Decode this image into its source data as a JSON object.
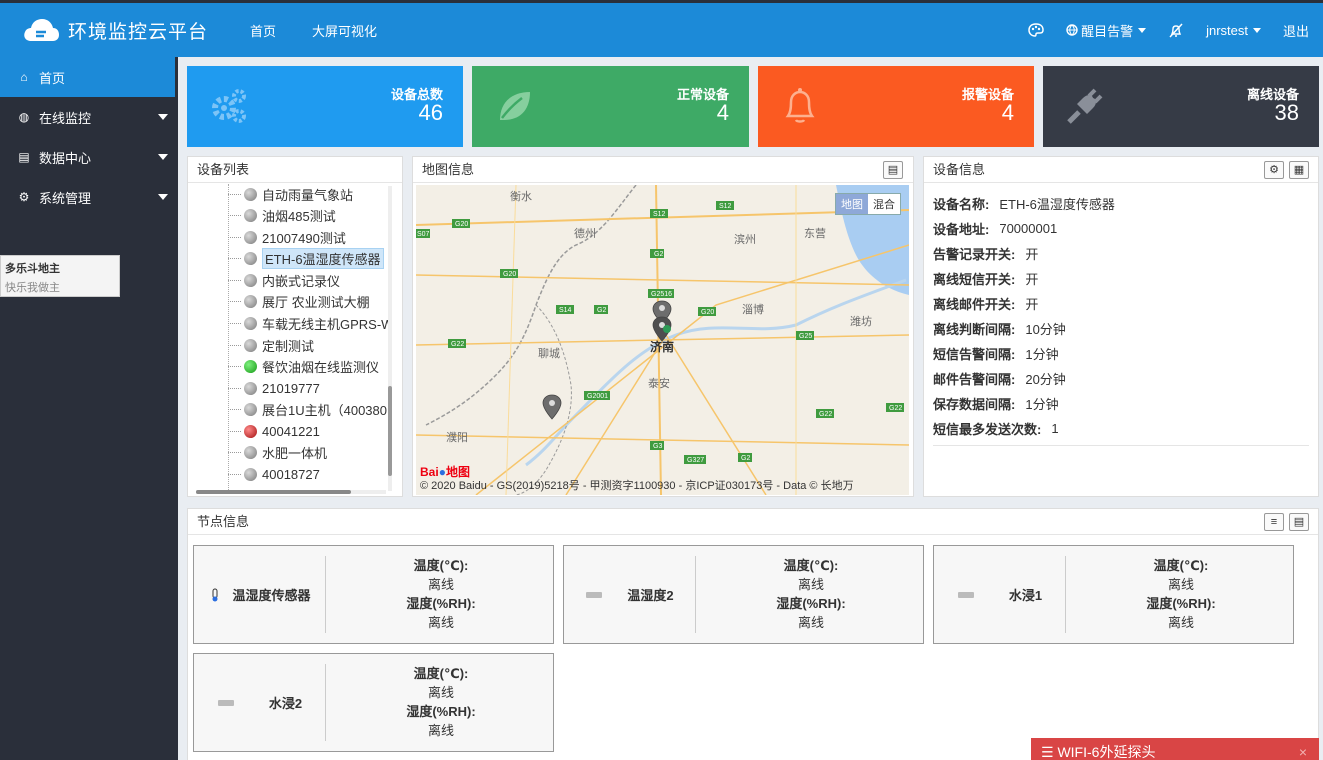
{
  "header": {
    "title": "环境监控云平台",
    "nav": [
      "首页",
      "大屏可视化"
    ],
    "alarm_label": "醒目告警",
    "username": "jnrstest",
    "logout": "退出"
  },
  "sidebar": {
    "items": [
      {
        "label": "首页",
        "icon": "home-icon"
      },
      {
        "label": "在线监控",
        "icon": "globe-icon"
      },
      {
        "label": "数据中心",
        "icon": "table-icon"
      },
      {
        "label": "系统管理",
        "icon": "gear-icon"
      }
    ],
    "tooltip": {
      "title": "多乐斗地主",
      "subtitle": "快乐我做主"
    }
  },
  "stats": [
    {
      "label": "设备总数",
      "value": "46",
      "color": "#1f9bf0",
      "icon": "gears-icon"
    },
    {
      "label": "正常设备",
      "value": "4",
      "color": "#3eaa66",
      "icon": "leaf-icon"
    },
    {
      "label": "报警设备",
      "value": "4",
      "color": "#fb5a21",
      "icon": "bell-icon"
    },
    {
      "label": "离线设备",
      "value": "38",
      "color": "#363b46",
      "icon": "plug-icon"
    }
  ],
  "device_list": {
    "title": "设备列表",
    "items": [
      {
        "label": "自动雨量气象站",
        "status": "offline"
      },
      {
        "label": "油烟485测试",
        "status": "offline"
      },
      {
        "label": "21007490测试",
        "status": "offline"
      },
      {
        "label": "ETH-6温湿度传感器",
        "status": "offline",
        "selected": true
      },
      {
        "label": "内嵌式记录仪",
        "status": "offline"
      },
      {
        "label": "展厅 农业测试大棚",
        "status": "offline"
      },
      {
        "label": "车载无线主机GPRS-W",
        "status": "offline"
      },
      {
        "label": "定制测试",
        "status": "offline"
      },
      {
        "label": "餐饮油烟在线监测仪",
        "status": "online"
      },
      {
        "label": "21019777",
        "status": "offline"
      },
      {
        "label": "展台1U主机（400380",
        "status": "offline"
      },
      {
        "label": "40041221",
        "status": "alarm"
      },
      {
        "label": "水肥一体机",
        "status": "offline"
      },
      {
        "label": "40018727",
        "status": "offline"
      }
    ]
  },
  "map": {
    "title": "地图信息",
    "toggle": [
      "地图",
      "混合"
    ],
    "copyright": "© 2020 Baidu - GS(2019)5218号 - 甲测资字1100930 - 京ICP证030173号 - Data © 长地万",
    "logo": "Bai地图",
    "cities": [
      "衡水",
      "德州",
      "滨州",
      "东营",
      "淄博",
      "潍坊",
      "济南",
      "聊城",
      "泰安",
      "濮阳"
    ],
    "roads": [
      "G20",
      "S12",
      "S12",
      "G2",
      "G20",
      "G2516",
      "S14",
      "G2",
      "G20",
      "G22",
      "G25",
      "G22",
      "G2001",
      "G3",
      "G327",
      "G2",
      "G22",
      "G22",
      "S07"
    ]
  },
  "device_info": {
    "title": "设备信息",
    "fields": [
      {
        "k": "设备名称:",
        "v": "ETH-6温湿度传感器"
      },
      {
        "k": "设备地址:",
        "v": "70000001"
      },
      {
        "k": "告警记录开关:",
        "v": "开"
      },
      {
        "k": "离线短信开关:",
        "v": "开"
      },
      {
        "k": "离线邮件开关:",
        "v": "开"
      },
      {
        "k": "离线判断间隔:",
        "v": "10分钟"
      },
      {
        "k": "短信告警间隔:",
        "v": "1分钟"
      },
      {
        "k": "邮件告警间隔:",
        "v": "20分钟"
      },
      {
        "k": "保存数据间隔:",
        "v": "1分钟"
      },
      {
        "k": "短信最多发送次数:",
        "v": "1"
      }
    ]
  },
  "nodes": {
    "title": "节点信息",
    "items": [
      {
        "name": "温湿度传感器",
        "icon": "thermometer-icon",
        "t_label": "温度(℃):",
        "t_val": "离线",
        "h_label": "湿度(%RH):",
        "h_val": "离线"
      },
      {
        "name": "温湿度2",
        "icon": "sensor-icon",
        "t_label": "温度(℃):",
        "t_val": "离线",
        "h_label": "湿度(%RH):",
        "h_val": "离线"
      },
      {
        "name": "水浸1",
        "icon": "sensor-icon",
        "t_label": "温度(℃):",
        "t_val": "离线",
        "h_label": "湿度(%RH):",
        "h_val": "离线"
      },
      {
        "name": "水浸2",
        "icon": "sensor-icon",
        "t_label": "温度(℃):",
        "t_val": "离线",
        "h_label": "湿度(%RH):",
        "h_val": "离线"
      }
    ]
  },
  "popup": {
    "title": "WIFI-6外延探头",
    "close": "×"
  }
}
